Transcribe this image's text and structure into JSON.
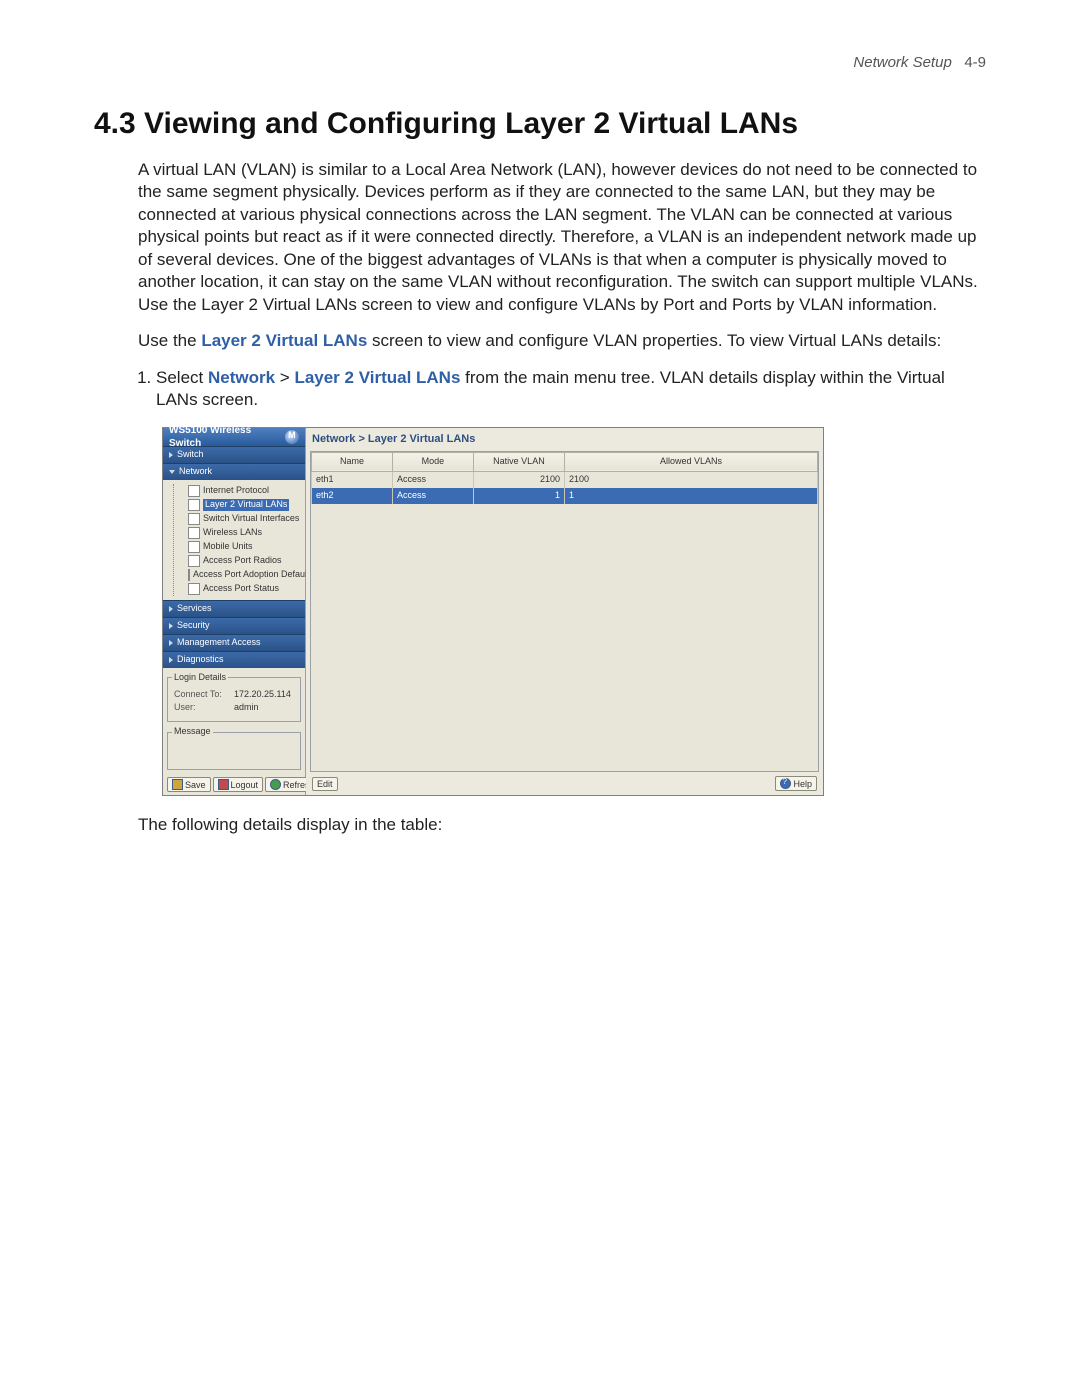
{
  "page_header": {
    "section": "Network Setup",
    "page_num": "4-9"
  },
  "heading": "4.3 Viewing and Configuring Layer 2 Virtual LANs",
  "para1": "A virtual LAN (VLAN) is similar to a Local Area Network (LAN), however devices do not need to be connected to the same segment physically. Devices perform as if they are connected to the same LAN, but they may be connected at various physical connections across the LAN segment. The VLAN can be connected at various physical points but react as if it were connected directly. Therefore, a VLAN is an independent network made up of several devices. One of the biggest advantages of VLANs is that when a computer is physically moved to another location, it can stay on the same VLAN without reconfiguration. The switch can support multiple VLANs. Use the Layer 2 Virtual LANs screen to view and configure VLANs by Port and Ports by VLAN information.",
  "para2_pre": "Use the ",
  "para2_link": "Layer 2 Virtual LANs",
  "para2_post": " screen to view and configure VLAN properties. To view Virtual LANs details:",
  "step1_pre": "Select ",
  "step1_net": "Network",
  "step1_gt": " > ",
  "step1_l2": "Layer 2 Virtual LANs",
  "step1_post": " from the main menu tree. VLAN details display within the Virtual LANs screen.",
  "caption_below": "The following details display in the table:",
  "app": {
    "product": "WS5100 Wireless Switch",
    "breadcrumb": "Network > Layer 2 Virtual LANs",
    "nav": {
      "switch": "Switch",
      "network": "Network",
      "services": "Services",
      "security": "Security",
      "mgmt": "Management Access",
      "diag": "Diagnostics"
    },
    "tree": {
      "ip": "Internet Protocol",
      "l2": "Layer 2 Virtual LANs",
      "svi": "Switch Virtual Interfaces",
      "wlans": "Wireless LANs",
      "mu": "Mobile Units",
      "apr": "Access Port Radios",
      "apad": "Access Port Adoption Defaults",
      "aps": "Access Port Status"
    },
    "login": {
      "legend": "Login Details",
      "connect_k": "Connect To:",
      "connect_v": "172.20.25.114",
      "user_k": "User:",
      "user_v": "admin"
    },
    "message_label": "Message",
    "buttons": {
      "save": "Save",
      "logout": "Logout",
      "refresh": "Refresh",
      "edit": "Edit",
      "help": "Help"
    },
    "columns": {
      "name": "Name",
      "mode": "Mode",
      "native": "Native VLAN",
      "allowed": "Allowed VLANs"
    },
    "rows": [
      {
        "name": "eth1",
        "mode": "Access",
        "native": "2100",
        "allowed": "2100"
      },
      {
        "name": "eth2",
        "mode": "Access",
        "native": "1",
        "allowed": "1"
      }
    ]
  }
}
